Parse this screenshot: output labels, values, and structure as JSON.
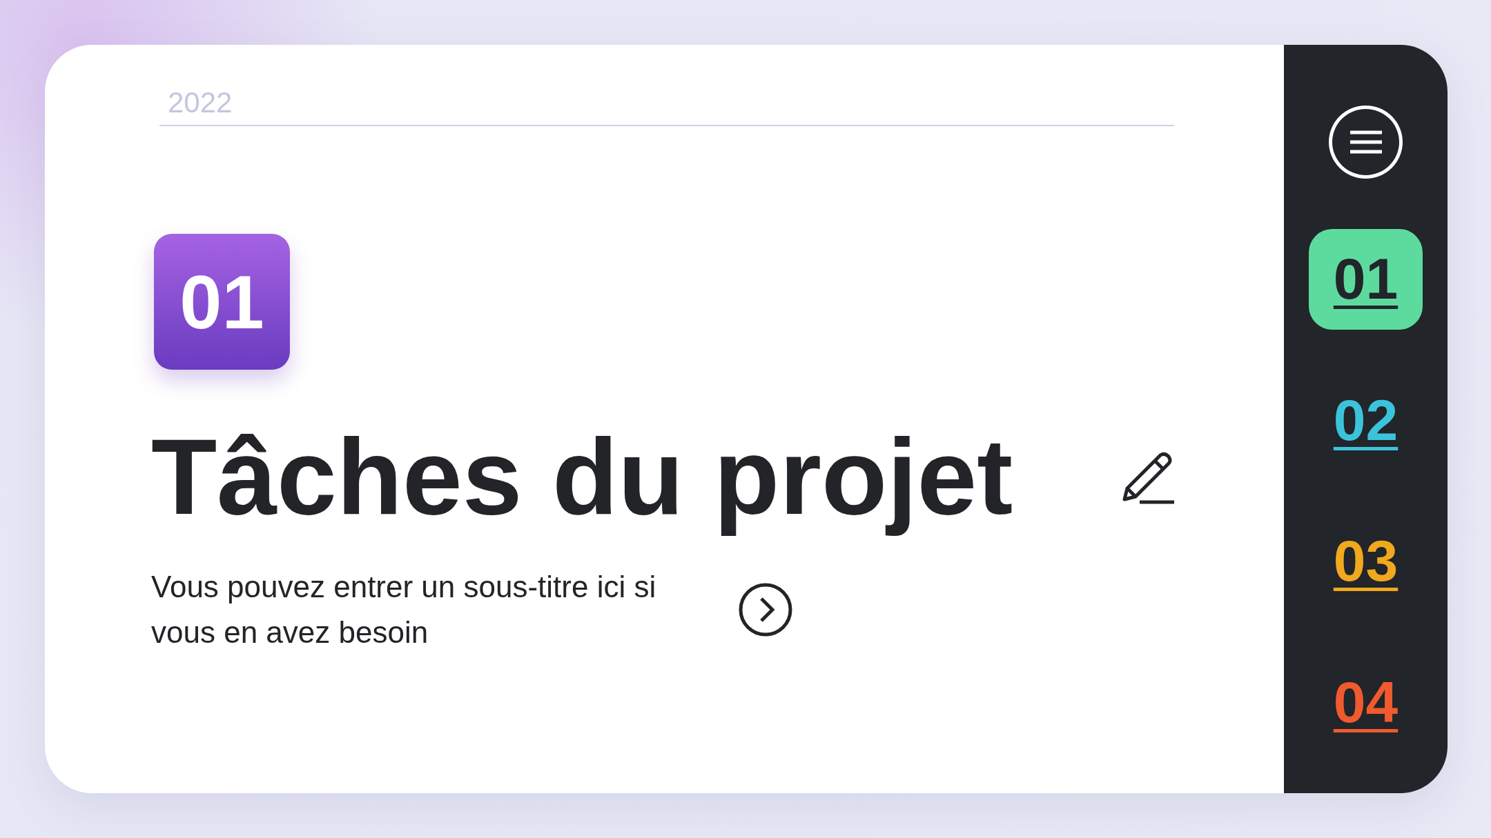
{
  "year": "2022",
  "badge": "01",
  "title": "Tâches du projet",
  "subtitle": "Vous pouvez entrer un sous-titre ici si vous en avez besoin",
  "sidebar": {
    "items": [
      {
        "label": "01",
        "selected": true,
        "color": "#5ddb9e"
      },
      {
        "label": "02",
        "selected": false,
        "color": "#3cc3dc"
      },
      {
        "label": "03",
        "selected": false,
        "color": "#f0a81e"
      },
      {
        "label": "04",
        "selected": false,
        "color": "#ef5a2e"
      }
    ]
  }
}
